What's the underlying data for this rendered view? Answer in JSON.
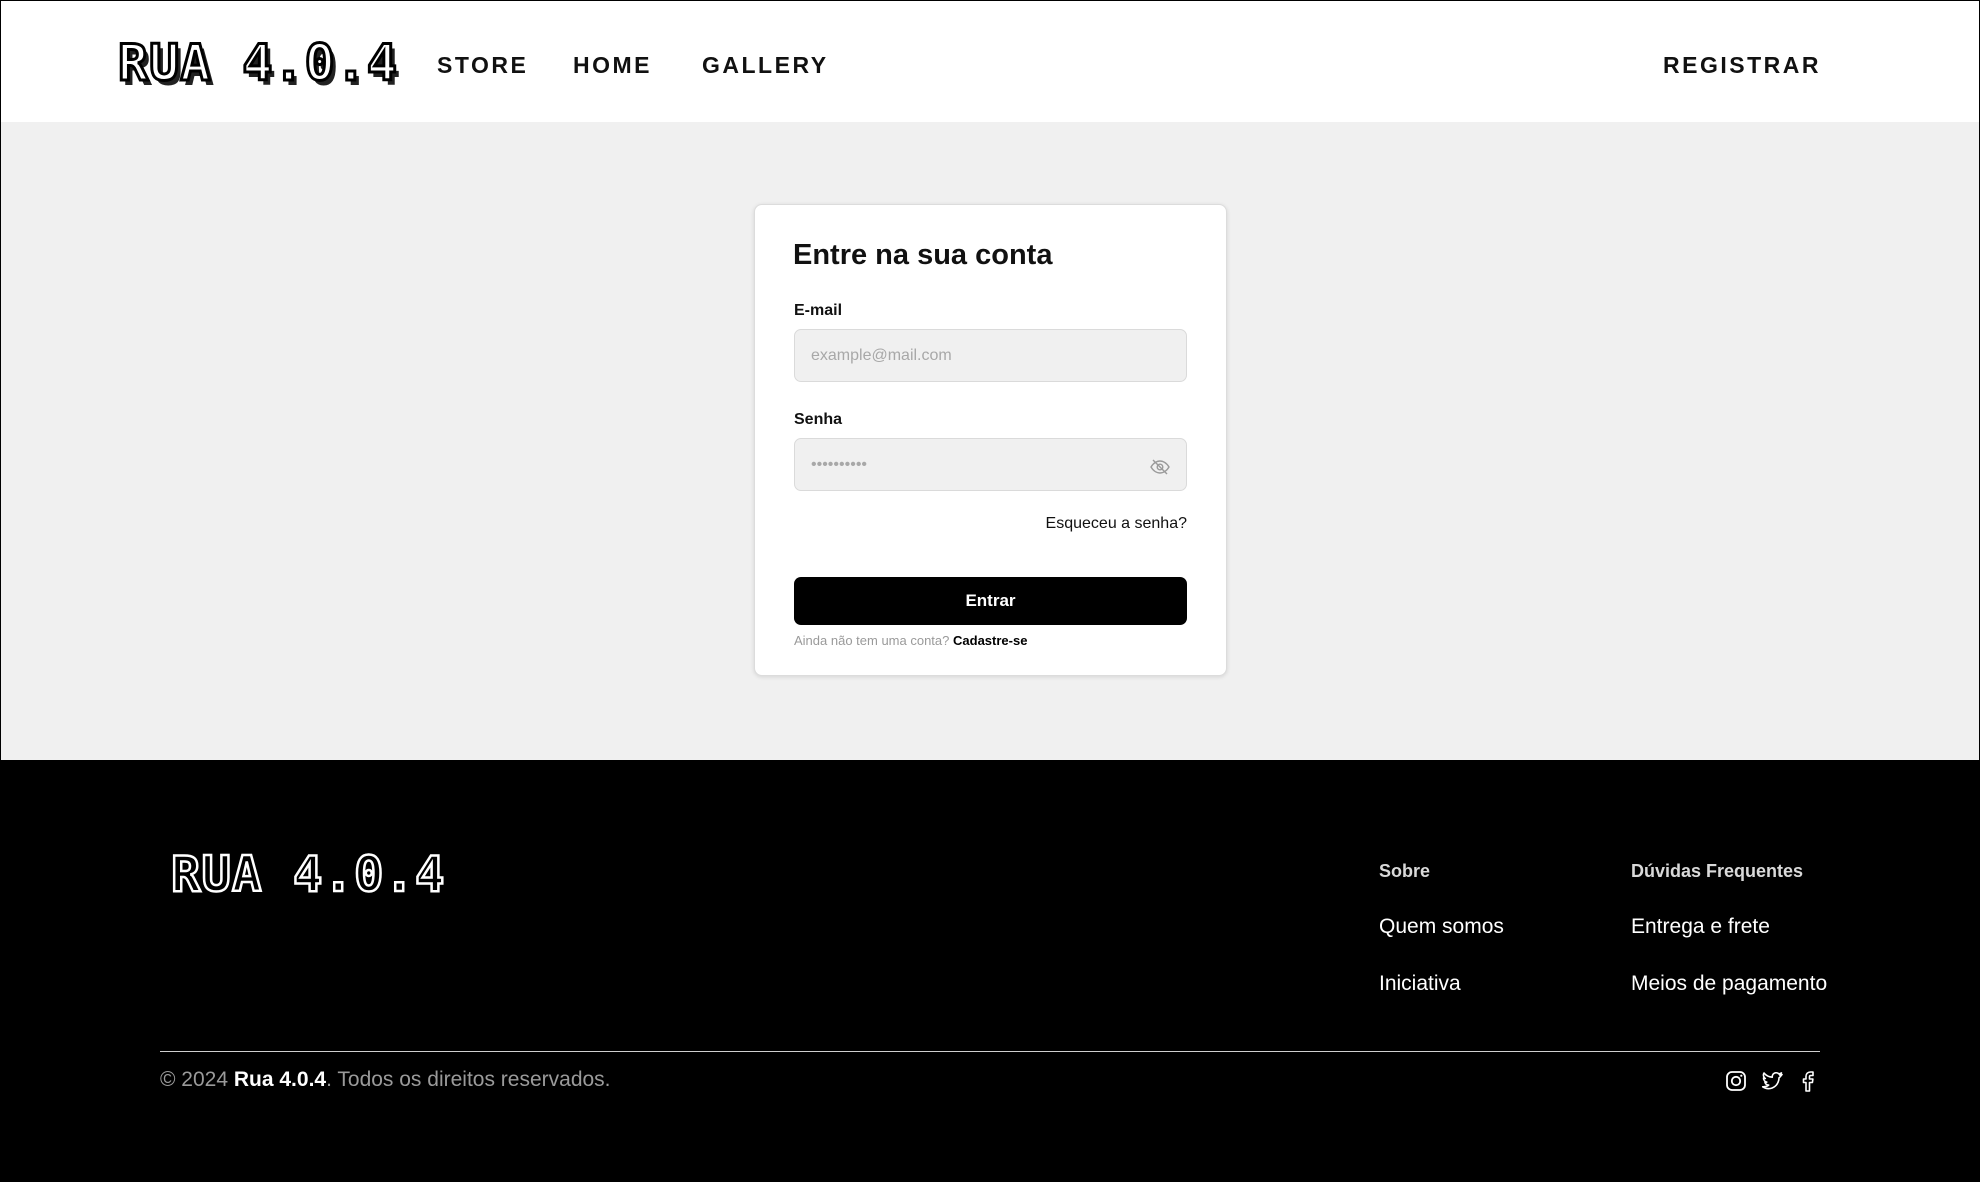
{
  "header": {
    "logo": "RUA 4.0.4",
    "nav": [
      "STORE",
      "HOME",
      "GALLERY"
    ],
    "register": "REGISTRAR"
  },
  "login": {
    "title": "Entre na sua conta",
    "email_label": "E-mail",
    "email_placeholder": "example@mail.com",
    "password_label": "Senha",
    "password_placeholder": "••••••••••",
    "forgot": "Esqueceu a senha?",
    "submit": "Entrar",
    "signup_prompt": "Ainda não tem uma conta?",
    "signup_link": "Cadastre-se"
  },
  "footer": {
    "logo": "RUA 4.0.4",
    "columns": [
      {
        "heading": "Sobre",
        "links": [
          "Quem somos",
          "Iniciativa"
        ]
      },
      {
        "heading": "Dúvidas Frequentes",
        "links": [
          "Entrega e frete",
          "Meios de pagamento"
        ]
      }
    ],
    "copyright_prefix": "© 2024",
    "copyright_brand": "Rua 4.0.4",
    "copyright_suffix": ". Todos os direitos reservados.",
    "social": [
      "instagram-icon",
      "twitter-icon",
      "facebook-icon"
    ]
  }
}
